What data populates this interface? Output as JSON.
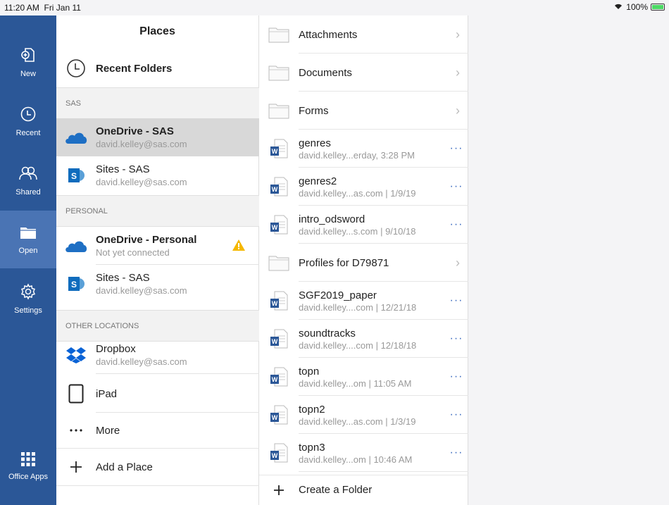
{
  "status": {
    "time": "11:20 AM",
    "date": "Fri Jan 11",
    "battery": "100%"
  },
  "rail": [
    {
      "label": "New",
      "icon": "new-document-icon"
    },
    {
      "label": "Recent",
      "icon": "clock-icon"
    },
    {
      "label": "Shared",
      "icon": "people-icon"
    },
    {
      "label": "Open",
      "icon": "folder-icon"
    },
    {
      "label": "Settings",
      "icon": "gear-icon"
    },
    {
      "label": "Office Apps",
      "icon": "app-grid-icon"
    }
  ],
  "places": {
    "title": "Places",
    "recent": "Recent Folders",
    "sections": {
      "sas": "SAS",
      "personal": "PERSONAL",
      "other": "OTHER LOCATIONS"
    },
    "items": [
      {
        "name": "OneDrive - SAS",
        "sub": "david.kelley@sas.com"
      },
      {
        "name": "Sites - SAS",
        "sub": "david.kelley@sas.com"
      },
      {
        "name": "OneDrive - Personal",
        "sub": "Not yet connected"
      },
      {
        "name": "Sites - SAS",
        "sub": "david.kelley@sas.com"
      },
      {
        "name": "Dropbox",
        "sub": "david.kelley@sas.com"
      },
      {
        "name": "iPad",
        "sub": ""
      },
      {
        "name": "More",
        "sub": ""
      },
      {
        "name": "Add a Place",
        "sub": ""
      }
    ]
  },
  "files": {
    "items": [
      {
        "name": "Attachments",
        "sub": "",
        "type": "folder"
      },
      {
        "name": "Documents",
        "sub": "",
        "type": "folder"
      },
      {
        "name": "Forms",
        "sub": "",
        "type": "folder"
      },
      {
        "name": "genres",
        "sub": "david.kelley...erday, 3:28 PM",
        "type": "word"
      },
      {
        "name": "genres2",
        "sub": "david.kelley...as.com | 1/9/19",
        "type": "word"
      },
      {
        "name": "intro_odsword",
        "sub": "david.kelley...s.com | 9/10/18",
        "type": "word"
      },
      {
        "name": "Profiles for D79871",
        "sub": "",
        "type": "folder"
      },
      {
        "name": "SGF2019_paper",
        "sub": "david.kelley....com | 12/21/18",
        "type": "word"
      },
      {
        "name": "soundtracks",
        "sub": "david.kelley....com | 12/18/18",
        "type": "word"
      },
      {
        "name": "topn",
        "sub": "david.kelley...om | 11:05 AM",
        "type": "word"
      },
      {
        "name": "topn2",
        "sub": "david.kelley...as.com | 1/3/19",
        "type": "word"
      },
      {
        "name": "topn3",
        "sub": "david.kelley...om | 10:46 AM",
        "type": "word"
      }
    ],
    "create": "Create a Folder"
  },
  "colors": {
    "rail": "#2b5797",
    "rail_active": "#4a74b4",
    "accent": "#3c6bbf",
    "warning": "#f5b800"
  }
}
